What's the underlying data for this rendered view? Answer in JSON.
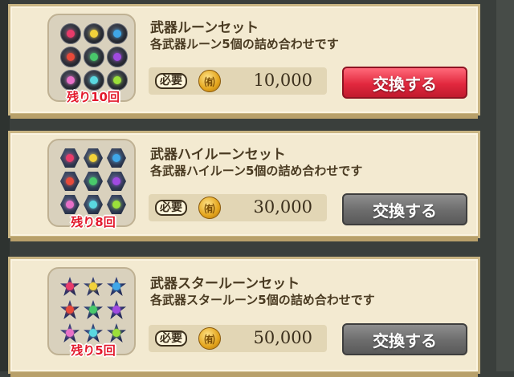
{
  "offers": [
    {
      "title": "武器ルーンセット",
      "description": "各武器ルーン5個の詰め合わせです",
      "remaining": "残り10回",
      "cost_label": "必要",
      "coin_icon": "guild-coin-icon",
      "amount": "10,000",
      "button_label": "交換する",
      "button_state": "active",
      "rune_shape": "orb"
    },
    {
      "title": "武器ハイルーンセット",
      "description": "各武器ハイルーン5個の詰め合わせです",
      "remaining": "残り8回",
      "cost_label": "必要",
      "coin_icon": "guild-coin-icon",
      "amount": "30,000",
      "button_label": "交換する",
      "button_state": "disabled",
      "rune_shape": "hex"
    },
    {
      "title": "武器スタールーンセット",
      "description": "各武器スタールーン5個の詰め合わせです",
      "remaining": "残り5回",
      "cost_label": "必要",
      "coin_icon": "guild-coin-icon",
      "amount": "50,000",
      "button_label": "交換する",
      "button_state": "disabled",
      "rune_shape": "star"
    }
  ],
  "coin_glyph": "㈲",
  "rune_colors": [
    "#e83b6a",
    "#f2d23a",
    "#3fa7e8",
    "#e84a3a",
    "#49c96b",
    "#a04ae0",
    "#e870c8",
    "#5ad8e0",
    "#9be03a"
  ]
}
